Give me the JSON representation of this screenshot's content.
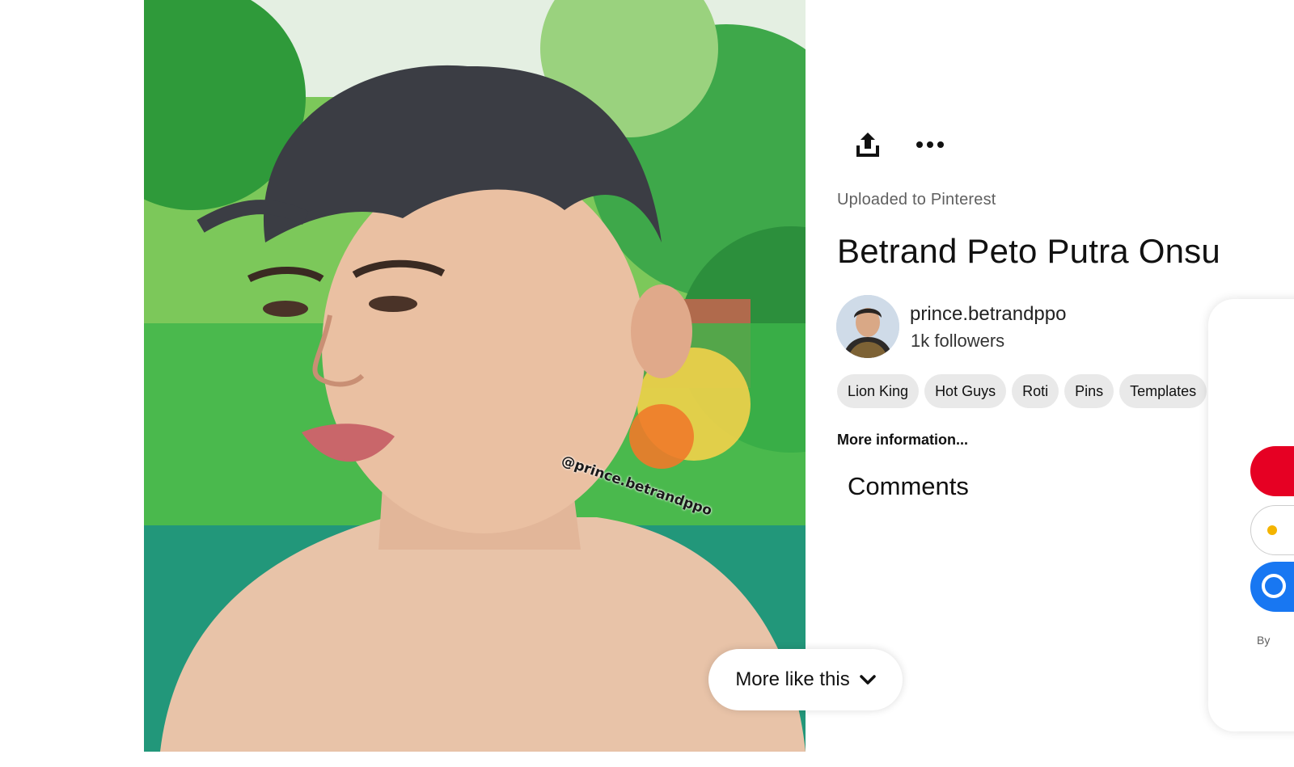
{
  "pin": {
    "image_alt": "Pin image",
    "watermark": "@prince.betrandppo",
    "source_label": "Uploaded to Pinterest",
    "title": "Betrand Peto Putra Onsu"
  },
  "toolbar": {
    "share_icon": "share-upload-icon",
    "more_icon": "ellipsis-icon"
  },
  "creator": {
    "name": "prince.betrandppo",
    "followers": "1k followers"
  },
  "tags": [
    "Lion King",
    "Hot Guys",
    "Roti",
    "Pins",
    "Templates"
  ],
  "more_information": "More information...",
  "comments": {
    "heading": "Comments"
  },
  "side_card": {
    "fineprint": "By"
  },
  "more_like_this": {
    "label": "More like this",
    "icon": "chevron-down-icon"
  },
  "colors": {
    "brand_red": "#e60023",
    "facebook_blue": "#1877f2",
    "tag_bg": "#e9e9e9"
  }
}
